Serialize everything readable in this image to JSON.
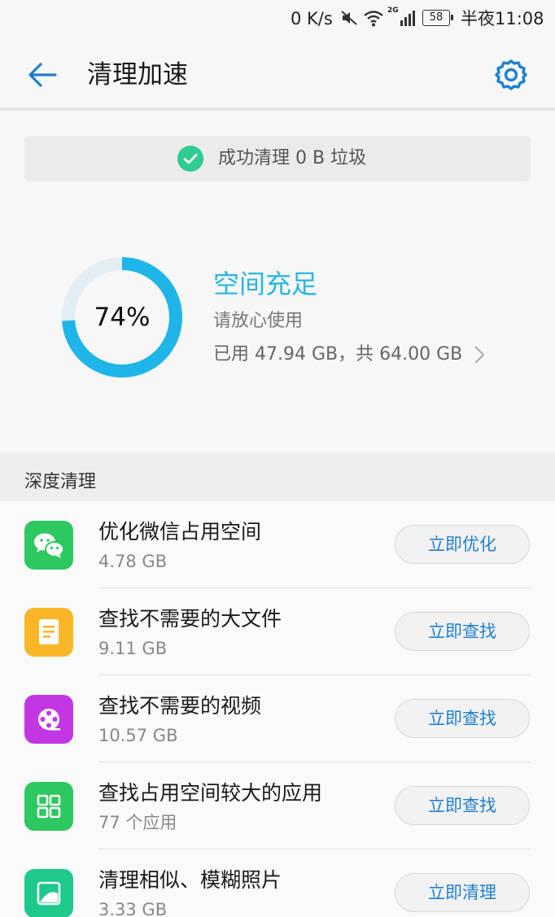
{
  "status_bar": {
    "speed": "0 K/s",
    "network": "2G",
    "battery": "58",
    "time": "半夜11:08"
  },
  "header": {
    "title": "清理加速",
    "back_icon": "arrow-left-icon",
    "settings_icon": "gear-icon",
    "accent_color": "#1f7fd1"
  },
  "banner": {
    "text": "成功清理 0 B 垃圾",
    "icon": "check-circle-icon",
    "icon_color": "#2ecc8f"
  },
  "storage": {
    "percent_label": "74%",
    "used_fraction": 0.74,
    "status_title": "空间充足",
    "status_subtitle": "请放心使用",
    "usage_text": "已用 47.94 GB，共 64.00 GB",
    "ring_color": "#1fb5e8",
    "ring_track_color": "#e3eef4"
  },
  "deep_clean": {
    "section_title": "深度清理",
    "items": [
      {
        "title": "优化微信占用空间",
        "subtitle": "4.78 GB",
        "button": "立即优化",
        "icon": "wechat-icon",
        "icon_color": "#2dc85f"
      },
      {
        "title": "查找不需要的大文件",
        "subtitle": "9.11 GB",
        "button": "立即查找",
        "icon": "document-icon",
        "icon_color": "#f9b728"
      },
      {
        "title": "查找不需要的视频",
        "subtitle": "10.57 GB",
        "button": "立即查找",
        "icon": "film-reel-icon",
        "icon_color": "#c237e3"
      },
      {
        "title": "查找占用空间较大的应用",
        "subtitle": "77 个应用",
        "button": "立即查找",
        "icon": "app-grid-icon",
        "icon_color": "#2dc85f"
      },
      {
        "title": "清理相似、模糊照片",
        "subtitle": "3.33 GB",
        "button": "立即清理",
        "icon": "photo-icon",
        "icon_color": "#1ec98a"
      }
    ]
  }
}
